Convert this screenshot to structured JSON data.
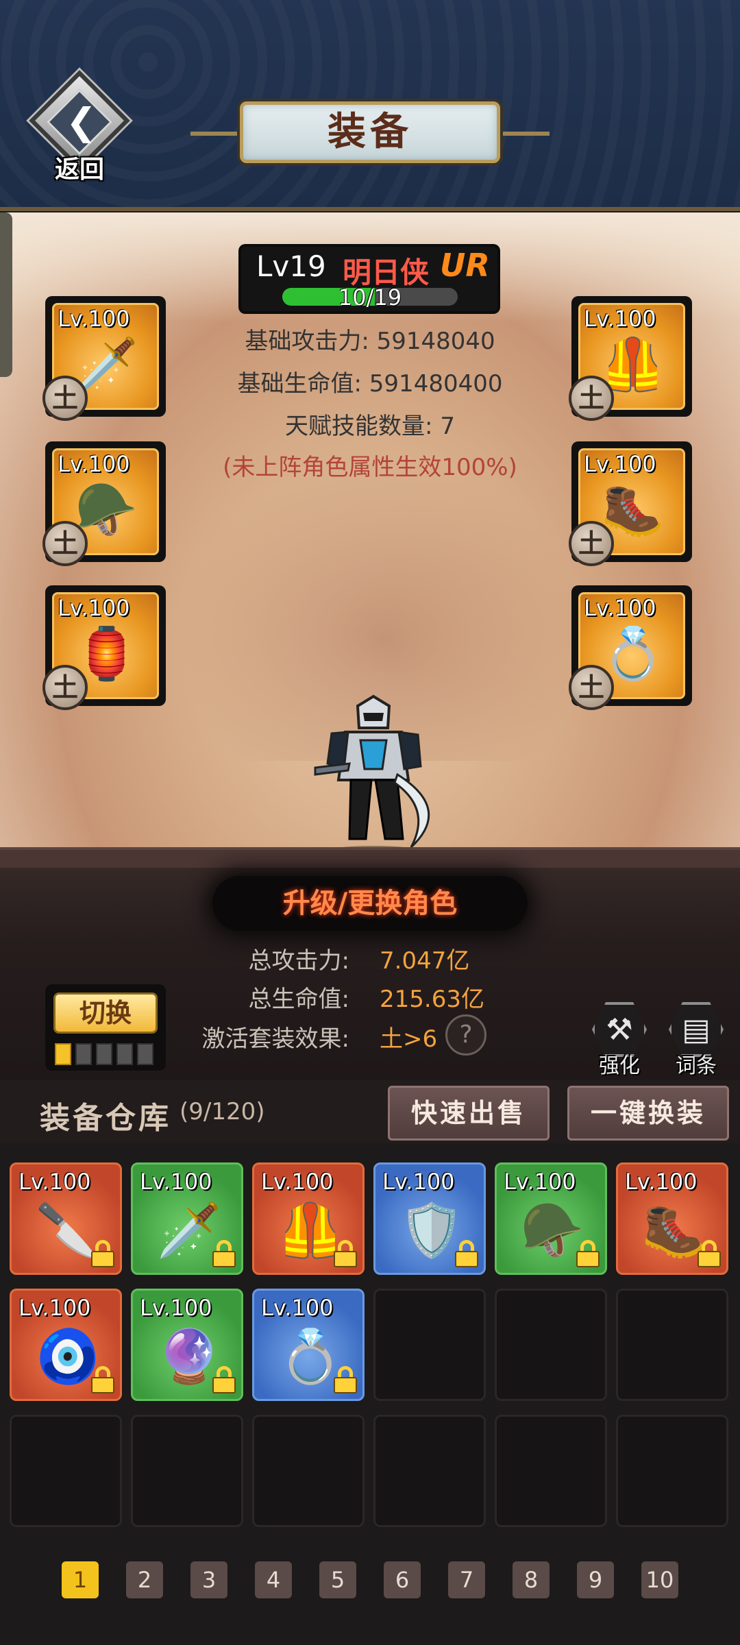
{
  "header": {
    "back_label": "返回",
    "title": "装备"
  },
  "hero": {
    "level": "Lv19",
    "name": "明日侠",
    "rank": "UR",
    "progress_text": "10/19",
    "progress_fraction": 0.5263,
    "base_attack_label": "基础攻击力:",
    "base_attack_value": "59148040",
    "base_hp_label": "基础生命值:",
    "base_hp_value": "591480400",
    "talent_label": "天赋技能数量:",
    "talent_value": "7",
    "note": "(未上阵角色属性生效100%)"
  },
  "equipped": [
    {
      "level": "Lv.100",
      "art": "🗡️",
      "badge": "土"
    },
    {
      "level": "Lv.100",
      "art": "🦺",
      "badge": "土"
    },
    {
      "level": "Lv.100",
      "art": "🪖",
      "badge": "土"
    },
    {
      "level": "Lv.100",
      "art": "🥾",
      "badge": "土"
    },
    {
      "level": "Lv.100",
      "art": "🏮",
      "badge": "土"
    },
    {
      "level": "Lv.100",
      "art": "💍",
      "badge": "土"
    }
  ],
  "summary": {
    "upgrade_banner": "升级/更换角色",
    "total_attack_label": "总攻击力:",
    "total_attack_value": "7.047亿",
    "total_hp_label": "总生命值:",
    "total_hp_value": "215.63亿",
    "set_label": "激活套装效果:",
    "set_value": "土>6",
    "help": "?"
  },
  "switch": {
    "label": "切换",
    "dots": [
      true,
      false,
      false,
      false,
      false
    ]
  },
  "tools": {
    "enhance_label": "强化",
    "affix_label": "词条"
  },
  "warehouse": {
    "title": "装备仓库",
    "count": "(9/120)",
    "quick_sell": "快速出售",
    "one_click": "一键换装",
    "items": [
      {
        "level": "Lv.100",
        "rarity": "r-red",
        "art": "🔪"
      },
      {
        "level": "Lv.100",
        "rarity": "r-green",
        "art": "🗡️"
      },
      {
        "level": "Lv.100",
        "rarity": "r-red",
        "art": "🦺"
      },
      {
        "level": "Lv.100",
        "rarity": "r-blue",
        "art": "🛡️"
      },
      {
        "level": "Lv.100",
        "rarity": "r-green",
        "art": "🪖"
      },
      {
        "level": "Lv.100",
        "rarity": "r-red",
        "art": "🥾"
      },
      {
        "level": "Lv.100",
        "rarity": "r-red",
        "art": "🧿"
      },
      {
        "level": "Lv.100",
        "rarity": "r-green",
        "art": "🔮"
      },
      {
        "level": "Lv.100",
        "rarity": "r-blue",
        "art": "💍"
      }
    ],
    "total_cells": 18
  },
  "pages": [
    "1",
    "2",
    "3",
    "4",
    "5",
    "6",
    "7",
    "8",
    "9",
    "10"
  ],
  "active_page": "1"
}
